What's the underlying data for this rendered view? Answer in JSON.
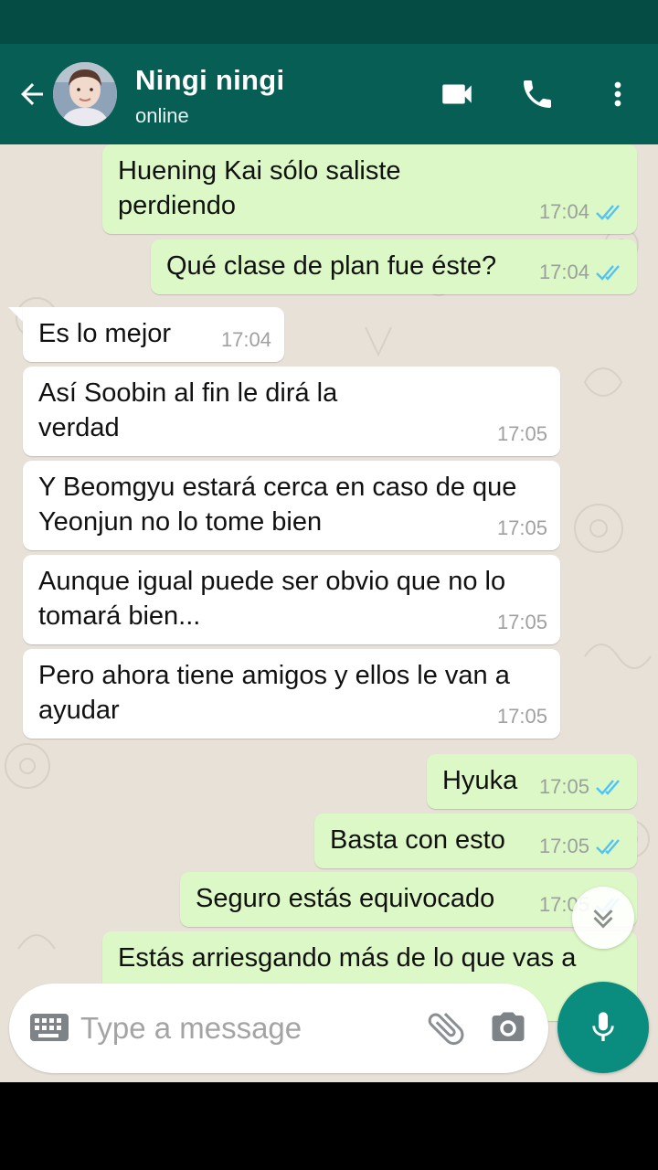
{
  "header": {
    "contact_name": "Ningi ningi",
    "contact_status": "online",
    "icons": [
      "arrow-back-icon",
      "videocam-icon",
      "phone-icon",
      "more-vert-icon"
    ]
  },
  "messages": [
    {
      "direction": "out",
      "text": "Huening Kai sólo saliste perdiendo",
      "time": "17:04",
      "status": "read"
    },
    {
      "direction": "out",
      "text": "Qué clase de plan fue éste?",
      "time": "17:04",
      "status": "read"
    },
    {
      "direction": "in",
      "text": "Es lo mejor",
      "time": "17:04"
    },
    {
      "direction": "in",
      "text": "Así Soobin al fin le dirá la verdad",
      "time": "17:05"
    },
    {
      "direction": "in",
      "text": "Y Beomgyu estará cerca en caso de que Yeonjun no lo tome bien",
      "time": "17:05"
    },
    {
      "direction": "in",
      "text": "Aunque igual puede ser obvio que no lo tomará bien...",
      "time": "17:05"
    },
    {
      "direction": "in",
      "text": "Pero ahora tiene amigos y ellos le van a ayudar",
      "time": "17:05"
    },
    {
      "direction": "out",
      "text": "Hyuka",
      "time": "17:05",
      "status": "read"
    },
    {
      "direction": "out",
      "text": "Basta con esto",
      "time": "17:05",
      "status": "read"
    },
    {
      "direction": "out",
      "text": "Seguro estás equivocado",
      "time": "17:05",
      "status": "read"
    },
    {
      "direction": "out",
      "text": "Estás arriesgando más de lo que vas a",
      "time": "",
      "status": ""
    }
  ],
  "composer": {
    "placeholder": "Type a message",
    "value": ""
  },
  "colors": {
    "header": "#075e54",
    "status_bar": "#054d44",
    "outgoing_bubble": "#dcf8c6",
    "incoming_bubble": "#ffffff",
    "chat_background": "#e7e1d8",
    "read_tick": "#4fc3f7",
    "mic_button": "#0a8d7e"
  }
}
